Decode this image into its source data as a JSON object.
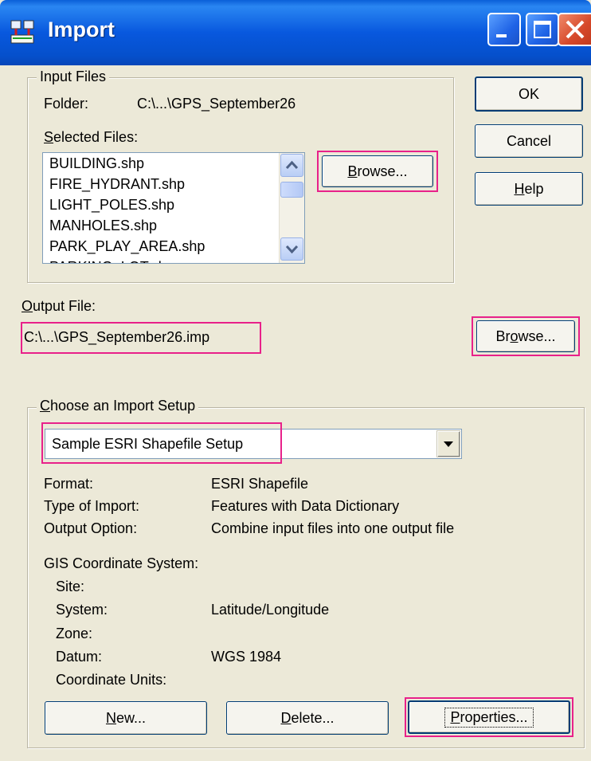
{
  "window": {
    "title": "Import"
  },
  "input_files": {
    "group_label": "Input Files",
    "folder_label": "Folder:",
    "folder_value": "C:\\...\\GPS_September26",
    "selected_files_label_u": "S",
    "selected_files_label_rest": "elected Files:",
    "files": [
      "BUILDING.shp",
      "FIRE_HYDRANT.shp",
      "LIGHT_POLES.shp",
      "MANHOLES.shp",
      "PARK_PLAY_AREA.shp",
      "PARKING_LOT.shp"
    ],
    "browse_u": "B",
    "browse_rest": "rowse..."
  },
  "buttons": {
    "ok": "OK",
    "cancel": "Cancel",
    "help_u": "H",
    "help_rest": "elp"
  },
  "output_file": {
    "label_u": "O",
    "label_rest": "utput File:",
    "value": "C:\\...\\GPS_September26.imp",
    "browse_pre": "Br",
    "browse_u": "o",
    "browse_rest": "wse..."
  },
  "import_setup": {
    "group_label_u": "C",
    "group_label_rest": "hoose an Import Setup",
    "selected": "Sample ESRI Shapefile Setup",
    "rows": [
      {
        "label": "Format:",
        "value": "ESRI Shapefile"
      },
      {
        "label": "Type of Import:",
        "value": "Features with Data Dictionary"
      },
      {
        "label": "Output Option:",
        "value": "Combine input files into one output file"
      }
    ],
    "gis_title": "GIS Coordinate System:",
    "gis_rows": [
      {
        "label": "Site:",
        "value": ""
      },
      {
        "label": "System:",
        "value": "Latitude/Longitude"
      },
      {
        "label": "Zone:",
        "value": ""
      },
      {
        "label": "Datum:",
        "value": "WGS 1984"
      },
      {
        "label": "Coordinate Units:",
        "value": ""
      }
    ],
    "new_u": "N",
    "new_rest": "ew...",
    "delete_u": "D",
    "delete_rest": "elete...",
    "properties_u": "P",
    "properties_rest": "roperties..."
  },
  "colors": {
    "highlight": "#e8218a",
    "titlebar": "#0858de",
    "dialog_bg": "#ece9d8"
  }
}
